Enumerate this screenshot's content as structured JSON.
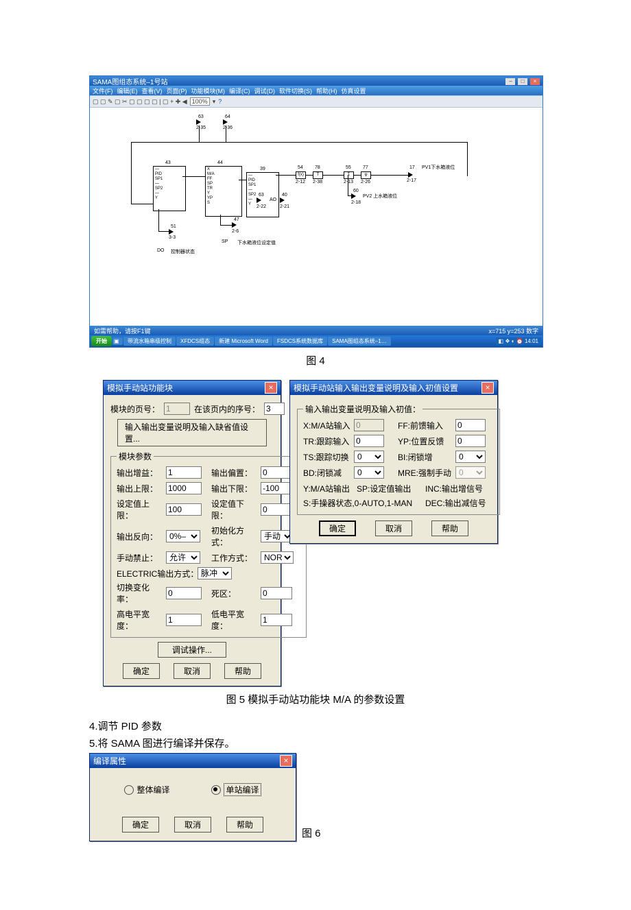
{
  "fig4": {
    "window_title": "SAMA图组态系统–1号站",
    "menus": [
      "文件(F)",
      "编辑(E)",
      "查看(V)",
      "页面(P)",
      "功能模块(M)",
      "编译(C)",
      "调试(D)",
      "软件切换(S)",
      "帮助(H)",
      "仿真设置"
    ],
    "zoom": "100%",
    "status_left": "如需帮助，请按F1键",
    "status_right": "x=715   y=253          数字",
    "taskbar_start": "开始",
    "taskbar_items": [
      "带流水箱串级控制",
      "XFDCS组态",
      "新建 Microsoft Word",
      "FSDCS系统数据库",
      "SAMA图组态系统–1…"
    ],
    "taskbar_time": "14:01",
    "canvas": {
      "n63": "63",
      "n63s": "2-35",
      "n64": "64",
      "n64s": "2-36",
      "b43": "43",
      "b44": "44",
      "b39": "39",
      "n54": "54",
      "n78": "78",
      "n55": "55",
      "n77": "77",
      "n54s": "2-12",
      "n78s": "2-38",
      "n55s": "2-13",
      "n77s": "2-26",
      "n17": "17",
      "n17s": "2-17",
      "n63b": "63",
      "n63bs": "2-22",
      "n40": "40",
      "n40s": "2-21",
      "n60": "60",
      "n60s": "2-18",
      "n51": "51",
      "n51s": "3-3",
      "n47": "47",
      "n47s": "2-6",
      "pid": "PID",
      "ma": "M/A",
      "ao": "AO",
      "do": "DO",
      "sp": "SP",
      "pv1": "PV1下水箱液位",
      "pv2": "PV2 上水箱液位",
      "ctrl_state": "控制器状态",
      "sp_text": "下水箱液位设定值",
      "fx": "f(x)",
      "fx2": "f(x)",
      "t": "T",
      "sigma": "Σ",
      "not": "ψ"
    }
  },
  "caption4": "图 4",
  "caption5": "图 5  模拟手动站功能块 M/A 的参数设置",
  "caption6": "图 6",
  "body1": "4.调节 PID 参数",
  "body2": "5.将 SAMA 图进行编译并保存。",
  "dlg_ma": {
    "title": "模拟手动站功能块",
    "page_label": "模块的页号：",
    "page_val": "1",
    "idx_label": "在该页内的序号：",
    "idx_val": "3",
    "iodesc_btn": "输入输出变量说明及输入缺省值设置...",
    "group": "模块参数",
    "rows": [
      [
        "输出增益：",
        "1",
        "输出偏置：",
        "0"
      ],
      [
        "输出上限：",
        "1000",
        "输出下限：",
        "-100"
      ],
      [
        "设定值上限：",
        "100",
        "设定值下限：",
        "0"
      ]
    ],
    "out_rev": "输出反向：",
    "out_rev_val": "0%–",
    "init": "初始化方式：",
    "init_val": "手动",
    "man_forbid": "手动禁止：",
    "man_forbid_val": "允许",
    "work": "工作方式：",
    "work_val": "NOR",
    "elec": "ELECTRIC输出方式：",
    "elec_val": "脉冲",
    "chg": "切换变化率：",
    "chg_val": "0",
    "dead": "死区：",
    "dead_val": "0",
    "hi": "高电平宽度：",
    "hi_val": "1",
    "lo": "低电平宽度：",
    "lo_val": "1",
    "debug": "调试操作...",
    "ok": "确定",
    "cancel": "取消",
    "help": "帮助"
  },
  "dlg_io": {
    "title": "模拟手动站输入输出变量说明及输入初值设置",
    "group": "输入输出变量说明及输入初值：",
    "x_lbl": "X:M/A站输入",
    "x_val": "0",
    "ff_lbl": "FF:前馈输入",
    "ff_val": "0",
    "tr_lbl": "TR:跟踪输入",
    "tr_val": "0",
    "yp_lbl": "YP:位置反馈",
    "yp_val": "0",
    "ts_lbl": "TS:跟踪切换",
    "ts_val": "0",
    "bi_lbl": "BI:闭锁增",
    "bi_val": "0",
    "bd_lbl": "BD:闭锁减",
    "bd_val": "0",
    "mre_lbl": "MRE:强制手动",
    "mre_val": "0",
    "y_lbl": "Y:M/A站输出",
    "sp_lbl": "SP:设定值输出",
    "inc_lbl": "INC:输出增信号",
    "s_lbl": "S:手操器状态,0-AUTO,1-MAN",
    "dec_lbl": "DEC:输出减信号",
    "ok": "确定",
    "cancel": "取消",
    "help": "帮助"
  },
  "dlg_compile": {
    "title": "编译属性",
    "whole": "整体编译",
    "single": "单站编译",
    "ok": "确定",
    "cancel": "取消",
    "help": "帮助"
  }
}
